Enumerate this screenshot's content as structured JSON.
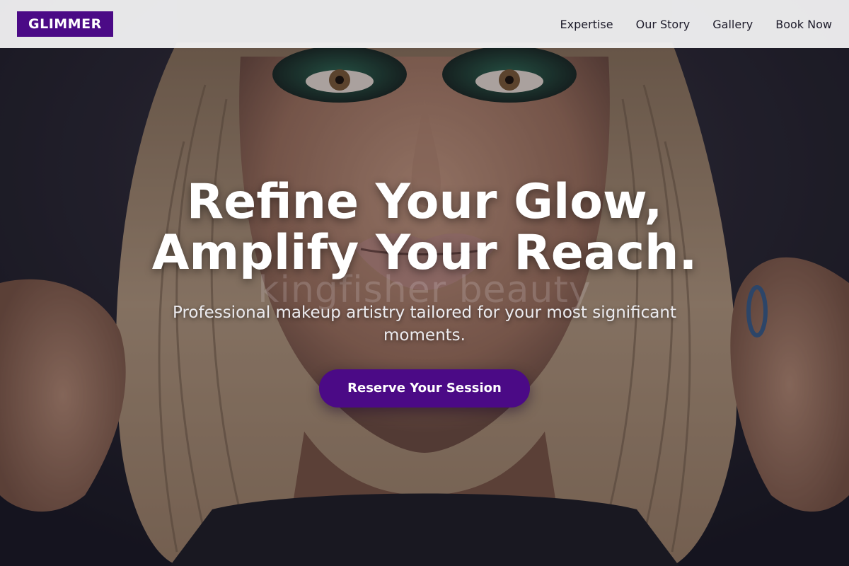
{
  "brand": {
    "logo_text": "GLIMMER",
    "accent_color": "#4b0a86"
  },
  "nav": {
    "items": [
      {
        "label": "Expertise"
      },
      {
        "label": "Our Story"
      },
      {
        "label": "Gallery"
      },
      {
        "label": "Book Now"
      }
    ]
  },
  "hero": {
    "headline_line1": "Refine Your Glow,",
    "headline_line2": "Amplify Your Reach.",
    "subheadline": "Professional makeup artistry tailored for your most significant moments.",
    "cta_label": "Reserve Your Session",
    "watermark_text": "kingfisher beauty",
    "background_image": "portrait-of-woman-with-glitter-eye-makeup"
  }
}
